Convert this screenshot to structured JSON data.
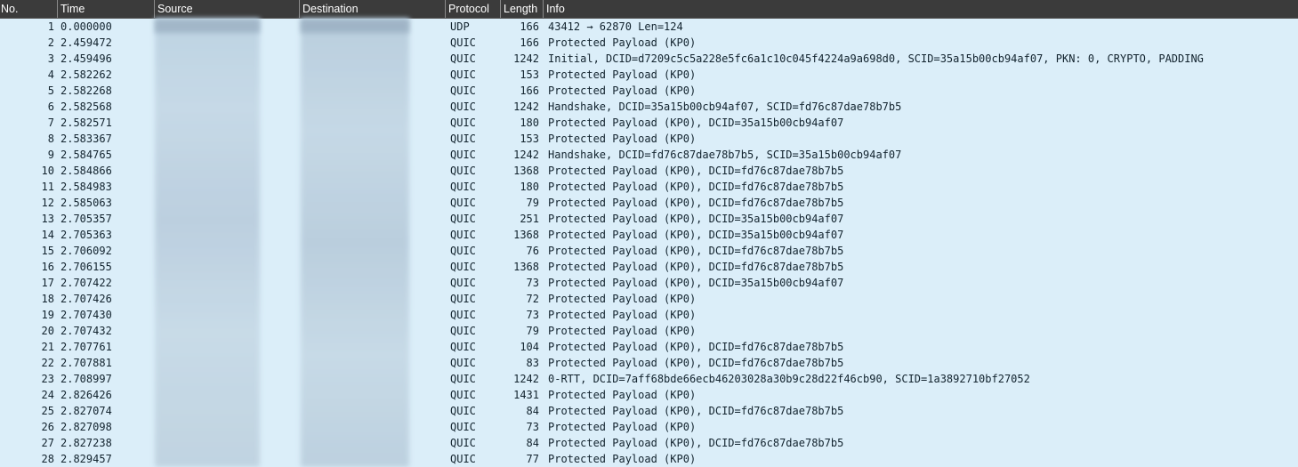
{
  "columns": {
    "no": "No.",
    "time": "Time",
    "source": "Source",
    "destination": "Destination",
    "protocol": "Protocol",
    "length": "Length",
    "info": "Info"
  },
  "packets": [
    {
      "no": "1",
      "time": "0.000000",
      "protocol": "UDP",
      "length": "166",
      "info": "43412 → 62870 Len=124"
    },
    {
      "no": "2",
      "time": "2.459472",
      "protocol": "QUIC",
      "length": "166",
      "info": "Protected Payload (KP0)"
    },
    {
      "no": "3",
      "time": "2.459496",
      "protocol": "QUIC",
      "length": "1242",
      "info": "Initial, DCID=d7209c5c5a228e5fc6a1c10c045f4224a9a698d0, SCID=35a15b00cb94af07, PKN: 0, CRYPTO, PADDING"
    },
    {
      "no": "4",
      "time": "2.582262",
      "protocol": "QUIC",
      "length": "153",
      "info": "Protected Payload (KP0)"
    },
    {
      "no": "5",
      "time": "2.582268",
      "protocol": "QUIC",
      "length": "166",
      "info": "Protected Payload (KP0)"
    },
    {
      "no": "6",
      "time": "2.582568",
      "protocol": "QUIC",
      "length": "1242",
      "info": "Handshake, DCID=35a15b00cb94af07, SCID=fd76c87dae78b7b5"
    },
    {
      "no": "7",
      "time": "2.582571",
      "protocol": "QUIC",
      "length": "180",
      "info": "Protected Payload (KP0), DCID=35a15b00cb94af07"
    },
    {
      "no": "8",
      "time": "2.583367",
      "protocol": "QUIC",
      "length": "153",
      "info": "Protected Payload (KP0)"
    },
    {
      "no": "9",
      "time": "2.584765",
      "protocol": "QUIC",
      "length": "1242",
      "info": "Handshake, DCID=fd76c87dae78b7b5, SCID=35a15b00cb94af07"
    },
    {
      "no": "10",
      "time": "2.584866",
      "protocol": "QUIC",
      "length": "1368",
      "info": "Protected Payload (KP0), DCID=fd76c87dae78b7b5"
    },
    {
      "no": "11",
      "time": "2.584983",
      "protocol": "QUIC",
      "length": "180",
      "info": "Protected Payload (KP0), DCID=fd76c87dae78b7b5"
    },
    {
      "no": "12",
      "time": "2.585063",
      "protocol": "QUIC",
      "length": "79",
      "info": "Protected Payload (KP0), DCID=fd76c87dae78b7b5"
    },
    {
      "no": "13",
      "time": "2.705357",
      "protocol": "QUIC",
      "length": "251",
      "info": "Protected Payload (KP0), DCID=35a15b00cb94af07"
    },
    {
      "no": "14",
      "time": "2.705363",
      "protocol": "QUIC",
      "length": "1368",
      "info": "Protected Payload (KP0), DCID=35a15b00cb94af07"
    },
    {
      "no": "15",
      "time": "2.706092",
      "protocol": "QUIC",
      "length": "76",
      "info": "Protected Payload (KP0), DCID=fd76c87dae78b7b5"
    },
    {
      "no": "16",
      "time": "2.706155",
      "protocol": "QUIC",
      "length": "1368",
      "info": "Protected Payload (KP0), DCID=fd76c87dae78b7b5"
    },
    {
      "no": "17",
      "time": "2.707422",
      "protocol": "QUIC",
      "length": "73",
      "info": "Protected Payload (KP0), DCID=35a15b00cb94af07"
    },
    {
      "no": "18",
      "time": "2.707426",
      "protocol": "QUIC",
      "length": "72",
      "info": "Protected Payload (KP0)"
    },
    {
      "no": "19",
      "time": "2.707430",
      "protocol": "QUIC",
      "length": "73",
      "info": "Protected Payload (KP0)"
    },
    {
      "no": "20",
      "time": "2.707432",
      "protocol": "QUIC",
      "length": "79",
      "info": "Protected Payload (KP0)"
    },
    {
      "no": "21",
      "time": "2.707761",
      "protocol": "QUIC",
      "length": "104",
      "info": "Protected Payload (KP0), DCID=fd76c87dae78b7b5"
    },
    {
      "no": "22",
      "time": "2.707881",
      "protocol": "QUIC",
      "length": "83",
      "info": "Protected Payload (KP0), DCID=fd76c87dae78b7b5"
    },
    {
      "no": "23",
      "time": "2.708997",
      "protocol": "QUIC",
      "length": "1242",
      "info": "0-RTT, DCID=7aff68bde66ecb46203028a30b9c28d22f46cb90, SCID=1a3892710bf27052"
    },
    {
      "no": "24",
      "time": "2.826426",
      "protocol": "QUIC",
      "length": "1431",
      "info": "Protected Payload (KP0)"
    },
    {
      "no": "25",
      "time": "2.827074",
      "protocol": "QUIC",
      "length": "84",
      "info": "Protected Payload (KP0), DCID=fd76c87dae78b7b5"
    },
    {
      "no": "26",
      "time": "2.827098",
      "protocol": "QUIC",
      "length": "73",
      "info": "Protected Payload (KP0)"
    },
    {
      "no": "27",
      "time": "2.827238",
      "protocol": "QUIC",
      "length": "84",
      "info": "Protected Payload (KP0), DCID=fd76c87dae78b7b5"
    },
    {
      "no": "28",
      "time": "2.829457",
      "protocol": "QUIC",
      "length": "77",
      "info": "Protected Payload (KP0)"
    }
  ],
  "colors": {
    "row_background": "#dbeef9",
    "header_background": "#3b3b3b",
    "header_text": "#ffffff",
    "row_text": "#12232e"
  }
}
